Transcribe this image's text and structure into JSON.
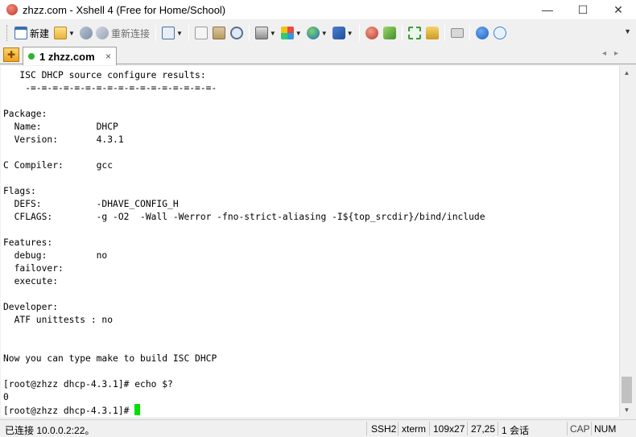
{
  "window": {
    "title": "zhzz.com - Xshell 4 (Free for Home/School)",
    "controls": {
      "minimize": "—",
      "maximize": "☐",
      "close": "✕"
    }
  },
  "toolbar": {
    "new_label": "新建",
    "reconnect_label": "重新连接"
  },
  "tabs": [
    {
      "label": "1 zhzz.com",
      "status_color": "#2fb32f"
    }
  ],
  "terminal": {
    "lines": [
      "   ISC DHCP source configure results:",
      "    -=-=-=-=-=-=-=-=-=-=-=-=-=-=-=-=-=-",
      "",
      "Package:",
      "  Name:          DHCP",
      "  Version:       4.3.1",
      "",
      "C Compiler:      gcc",
      "",
      "Flags:",
      "  DEFS:          -DHAVE_CONFIG_H",
      "  CFLAGS:        -g -O2  -Wall -Werror -fno-strict-aliasing -I${top_srcdir}/bind/include",
      "",
      "Features:",
      "  debug:         no",
      "  failover:",
      "  execute:",
      "",
      "Developer:",
      "  ATF unittests : no",
      "",
      "",
      "Now you can type make to build ISC DHCP",
      "",
      "[root@zhzz dhcp-4.3.1]# echo $?",
      "0"
    ],
    "prompt": "[root@zhzz dhcp-4.3.1]# ",
    "cursor_color": "#00e000"
  },
  "statusbar": {
    "connection": "已连接 10.0.0.2:22。",
    "protocol": "SSH2",
    "term_type": "xterm",
    "size": "109x27",
    "cursor_pos": "27,25",
    "sessions": "1 会话",
    "caps": "CAP",
    "num": "NUM"
  }
}
